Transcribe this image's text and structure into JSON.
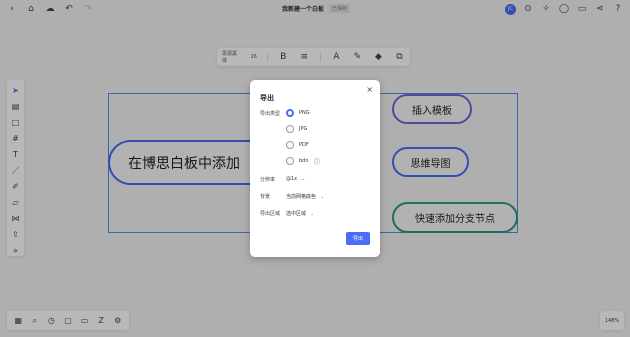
{
  "topbar": {
    "doc_title": "我新建一个白板",
    "doc_tag": "已保存",
    "avatar_text": "JC",
    "left_icons": [
      "menu-icon",
      "home-icon",
      "cloud-icon",
      "undo-icon",
      "redo-icon"
    ],
    "right_icons": [
      "play-icon",
      "sparkle-icon",
      "comment-icon",
      "history-icon",
      "share-icon",
      "help-icon"
    ]
  },
  "format_toolbar": {
    "font_label": "思源黑体",
    "font_size": "26",
    "icons": [
      "bold-icon",
      "align-icon",
      "text-color-icon",
      "brush-icon",
      "fill-icon",
      "link-icon"
    ]
  },
  "canvas": {
    "root_text": "在博思白板中添加",
    "child1_text": "插入模板",
    "child2_text": "思维导图",
    "child3_text": "快速添加分支节点",
    "colors": {
      "root": "#4a6cf7",
      "child1": "#7d5fd8",
      "child2": "#4a6cf7",
      "child3": "#2a9c7a"
    }
  },
  "modal": {
    "title": "导出",
    "close_symbol": "×",
    "type_label": "导出类型",
    "options": [
      "PNG",
      "JPG",
      "PDF",
      "bdn"
    ],
    "selected_option": "PNG",
    "resolution_label": "分辨率",
    "resolution_value": "@1x",
    "background_label": "背景",
    "background_value": "当前网格底色",
    "range_label": "导出区域",
    "range_value": "选中区域",
    "export_button": "导出"
  },
  "zoom": {
    "level": "148%"
  }
}
